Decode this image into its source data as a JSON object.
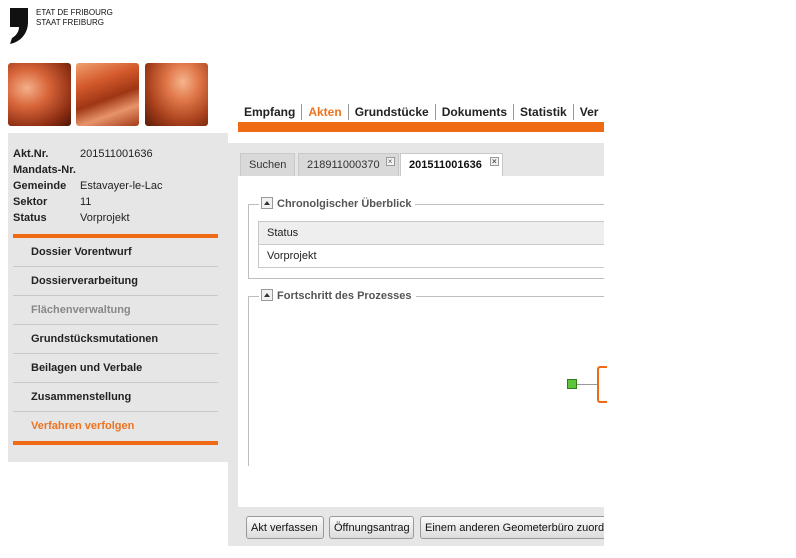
{
  "header": {
    "logo_line1": "ETAT DE FRIBOURG",
    "logo_line2": "STAAT FREIBURG"
  },
  "nav": {
    "items": [
      {
        "label": "Empfang"
      },
      {
        "label": "Akten"
      },
      {
        "label": "Grundstücke"
      },
      {
        "label": "Dokuments"
      },
      {
        "label": "Statistik"
      },
      {
        "label": "Ver"
      }
    ],
    "active": "Akten",
    "accent_color": "#ee6a14"
  },
  "dossier_info": {
    "rows": [
      {
        "key": "Akt.Nr.",
        "value": "201511001636"
      },
      {
        "key": "Mandats-Nr.",
        "value": ""
      },
      {
        "key": "Gemeinde",
        "value": "Estavayer-le-Lac"
      },
      {
        "key": "Sektor",
        "value": "11"
      },
      {
        "key": "Status",
        "value": "Vorprojekt"
      }
    ]
  },
  "side_menu": {
    "items": [
      {
        "label": "Dossier Vorentwurf",
        "state": "normal"
      },
      {
        "label": "Dossierverarbeitung",
        "state": "normal"
      },
      {
        "label": "Flächenverwaltung",
        "state": "disabled"
      },
      {
        "label": "Grundstücksmutationen",
        "state": "normal"
      },
      {
        "label": "Beilagen und Verbale",
        "state": "normal"
      },
      {
        "label": "Zusammenstellung",
        "state": "normal"
      },
      {
        "label": "Verfahren verfolgen",
        "state": "current"
      }
    ]
  },
  "tabs": [
    {
      "label": "Suchen",
      "closable": false,
      "active": false
    },
    {
      "label": "218911000370",
      "closable": true,
      "active": false
    },
    {
      "label": "201511001636",
      "closable": true,
      "active": true
    }
  ],
  "overview": {
    "legend": "Chronolgischer Überblick",
    "column_header": "Status",
    "rows": [
      "Vorprojekt"
    ]
  },
  "progress": {
    "legend": "Fortschritt des Prozesses"
  },
  "actions": {
    "buttons": [
      {
        "label": "Akt verfassen"
      },
      {
        "label": "Öffnungsantrag"
      },
      {
        "label": "Einem anderen Geometerbüro zuordnen"
      }
    ]
  }
}
